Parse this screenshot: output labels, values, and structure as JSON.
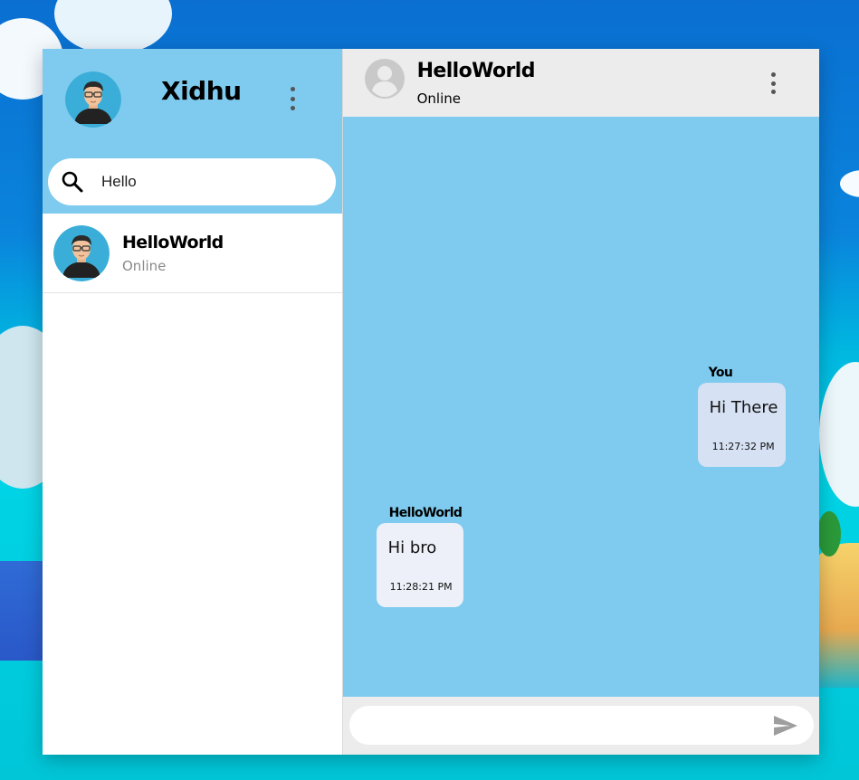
{
  "window": {
    "title": ""
  },
  "sidebar": {
    "profile_name": "Xidhu",
    "search": {
      "value": "Hello",
      "placeholder": ""
    },
    "contacts": [
      {
        "name": "HelloWorld",
        "status": "Online"
      }
    ]
  },
  "chat": {
    "header": {
      "name": "HelloWorld",
      "status": "Online"
    },
    "messages": [
      {
        "sender": "You",
        "text": "Hi There",
        "time": "11:27:32 PM",
        "side": "right",
        "bubble_color": "#d6e1f3"
      },
      {
        "sender": "HelloWorld",
        "text": "Hi bro",
        "time": "11:28:21 PM",
        "side": "left",
        "bubble_color": "#edf0f8"
      }
    ],
    "composer": {
      "value": "",
      "placeholder": ""
    }
  },
  "icons": {
    "profile_avatar": "user-avatar-icon",
    "sidebar_menu": "more-vertical-icon",
    "search": "search-icon",
    "contact_avatar": "user-avatar-icon",
    "chat_header_avatar": "account-circle-icon",
    "chat_menu": "more-vertical-icon",
    "send": "send-icon"
  },
  "colors": {
    "accent": "#7ecbef",
    "header_gray": "#ececec",
    "sent_bubble": "#d6e1f3",
    "received_bubble": "#edf0f8"
  }
}
